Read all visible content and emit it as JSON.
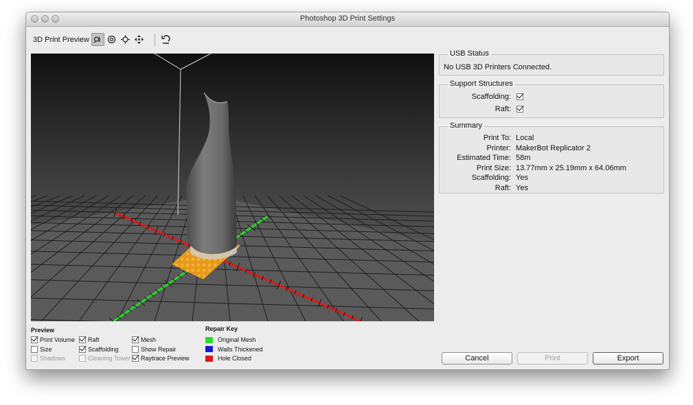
{
  "window": {
    "title": "Photoshop 3D Print Settings"
  },
  "toolbar": {
    "label": "3D Print Preview",
    "tools": [
      "orbit-icon",
      "roll-icon",
      "pan-icon",
      "slide-icon",
      "reset-view-icon"
    ]
  },
  "usb_status": {
    "title": "USB Status",
    "message": "No USB 3D Printers Connected."
  },
  "support_structures": {
    "title": "Support Structures",
    "scaffolding_label": "Scaffolding:",
    "scaffolding_checked": true,
    "raft_label": "Raft:",
    "raft_checked": true
  },
  "summary": {
    "title": "Summary",
    "rows": [
      {
        "key": "Print To:",
        "value": "Local"
      },
      {
        "key": "Printer:",
        "value": "MakerBot Replicator 2"
      },
      {
        "key": "Estimated Time:",
        "value": "58m"
      },
      {
        "key": "Print Size:",
        "value": "13.77mm x 25.19mm x 64.06mm"
      },
      {
        "key": "Scaffolding:",
        "value": "Yes"
      },
      {
        "key": "Raft:",
        "value": "Yes"
      }
    ]
  },
  "preview": {
    "title": "Preview",
    "items": [
      {
        "label": "Print Volume",
        "checked": true,
        "enabled": true
      },
      {
        "label": "Size",
        "checked": false,
        "enabled": true
      },
      {
        "label": "Shadows",
        "checked": false,
        "enabled": false
      },
      {
        "label": "Raft",
        "checked": true,
        "enabled": true
      },
      {
        "label": "Scaffolding",
        "checked": true,
        "enabled": true
      },
      {
        "label": "Cleaning Tower",
        "checked": false,
        "enabled": false
      },
      {
        "label": "Mesh",
        "checked": true,
        "enabled": true
      },
      {
        "label": "Show Repair",
        "checked": false,
        "enabled": true
      },
      {
        "label": "Raytrace Preview",
        "checked": true,
        "enabled": true
      }
    ]
  },
  "repair_key": {
    "title": "Repair Key",
    "items": [
      {
        "label": "Original Mesh",
        "color": "#2bdc2b"
      },
      {
        "label": "Walls Thickened",
        "color": "#1a1ad6"
      },
      {
        "label": "Hole Closed",
        "color": "#e01818"
      }
    ]
  },
  "buttons": {
    "cancel": "Cancel",
    "print": "Print",
    "export": "Export"
  },
  "colors": {
    "axis_x": "#e01818",
    "axis_y": "#29d629",
    "raft": "#e79a1a"
  }
}
